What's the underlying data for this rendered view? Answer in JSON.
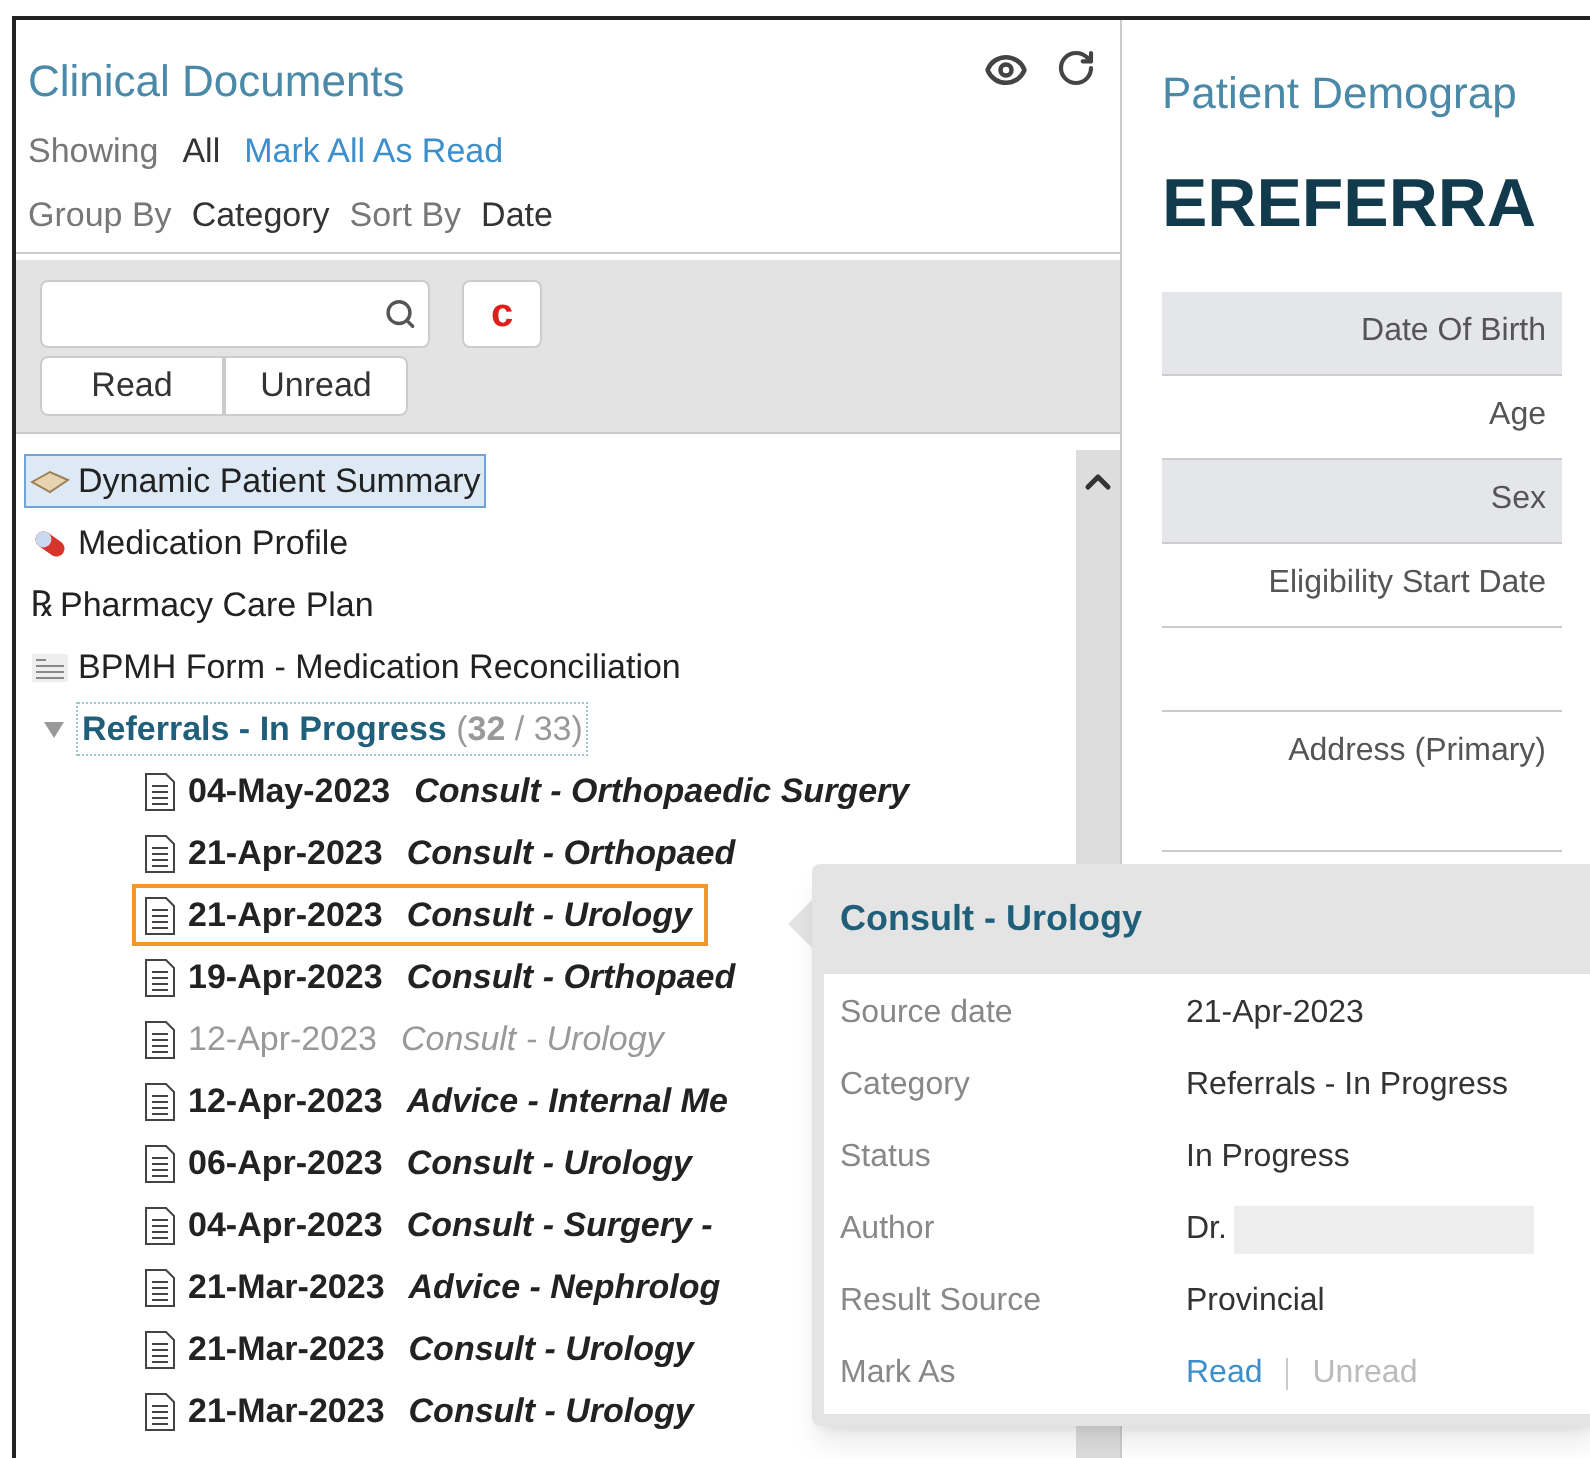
{
  "documents_panel": {
    "title": "Clinical Documents",
    "showing_label": "Showing",
    "showing_value": "All",
    "mark_all_link": "Mark All As Read",
    "group_by_label": "Group By",
    "group_by_value": "Category",
    "sort_by_label": "Sort By",
    "sort_by_value": "Date",
    "clear_button": "c",
    "filter_buttons": [
      "Read",
      "Unread"
    ],
    "tree": [
      {
        "kind": "summary",
        "label": "Dynamic Patient Summary",
        "selected": true
      },
      {
        "kind": "medication",
        "label": "Medication Profile",
        "selected": false
      },
      {
        "kind": "rx",
        "glyph": "℞",
        "label": "Pharmacy Care Plan",
        "selected": false
      },
      {
        "kind": "form",
        "label": "BPMH Form - Medication Reconciliation",
        "selected": false
      },
      {
        "kind": "group",
        "label": "Referrals - In Progress",
        "counts": "(**32** / 33)",
        "expanded": true,
        "children": [
          {
            "date": "04-May-2023",
            "title": "Consult - Orthopaedic Surgery",
            "unread": true,
            "selected": false
          },
          {
            "date": "21-Apr-2023",
            "title": "Consult - Orthopaed",
            "unread": true,
            "selected": false
          },
          {
            "date": "21-Apr-2023",
            "title": "Consult - Urology",
            "unread": true,
            "selected": true
          },
          {
            "date": "19-Apr-2023",
            "title": "Consult - Orthopaed",
            "unread": true,
            "selected": false
          },
          {
            "date": "12-Apr-2023",
            "title": "Consult - Urology",
            "unread": false,
            "selected": false
          },
          {
            "date": "12-Apr-2023",
            "title": "Advice - Internal Me",
            "unread": true,
            "selected": false
          },
          {
            "date": "06-Apr-2023",
            "title": "Consult - Urology",
            "unread": true,
            "selected": false
          },
          {
            "date": "04-Apr-2023",
            "title": "Consult - Surgery -",
            "unread": true,
            "selected": false
          },
          {
            "date": "21-Mar-2023",
            "title": "Advice - Nephrolog",
            "unread": true,
            "selected": false
          },
          {
            "date": "21-Mar-2023",
            "title": "Consult - Urology",
            "unread": true,
            "selected": false
          },
          {
            "date": "21-Mar-2023",
            "title": "Consult - Urology",
            "unread": true,
            "selected": false
          }
        ]
      }
    ]
  },
  "demographics_panel": {
    "title": "Patient Demograp",
    "heading": "EREFERRA",
    "rows": [
      {
        "label": "Date Of Birth"
      },
      {
        "label": "Age"
      },
      {
        "label": "Sex"
      },
      {
        "label": "Eligibility Start Date"
      },
      {},
      {
        "label": "Address (Primary)"
      }
    ]
  },
  "popover": {
    "title": "Consult - Urology",
    "details": [
      {
        "label": "Source date",
        "value": "21-Apr-2023"
      },
      {
        "label": "Category",
        "value": "Referrals - In Progress"
      },
      {
        "label": "Status",
        "value": "In Progress"
      },
      {
        "label": "Author",
        "value": "Dr.",
        "redacted": true
      },
      {
        "label": "Result Source",
        "value": "Provincial"
      }
    ],
    "mark_as_label": "Mark As",
    "mark_as_options": [
      {
        "label": "Read",
        "disabled": false
      },
      {
        "label": "Unread",
        "disabled": true
      }
    ]
  }
}
